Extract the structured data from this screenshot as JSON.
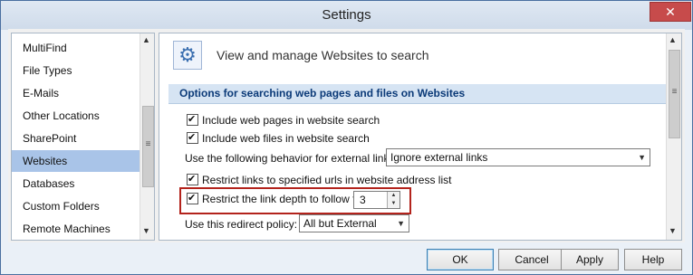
{
  "window": {
    "title": "Settings",
    "close_glyph": "✕"
  },
  "nav": {
    "items": [
      {
        "label": "MultiFind"
      },
      {
        "label": "File Types"
      },
      {
        "label": "E-Mails"
      },
      {
        "label": "Other Locations"
      },
      {
        "label": "SharePoint"
      },
      {
        "label": "Websites",
        "selected": true
      },
      {
        "label": "Databases"
      },
      {
        "label": "Custom Folders"
      },
      {
        "label": "Remote Machines"
      }
    ],
    "scroll_up": "▲",
    "scroll_down": "▼",
    "grip": "≡"
  },
  "panel": {
    "header_icon": "gear-icon",
    "header_glyph": "⚙",
    "header_text": "View and manage Websites to search",
    "section_title": "Options for searching web pages and files on Websites",
    "include_pages": {
      "label": "Include web pages in website search",
      "checked": true
    },
    "include_files": {
      "label": "Include web files in website search",
      "checked": true
    },
    "external_links": {
      "label": "Use the following behavior for external links:",
      "value": "Ignore external links"
    },
    "restrict_urls": {
      "label": "Restrict links to specified urls in website address list",
      "checked": true
    },
    "restrict_depth": {
      "label": "Restrict the link depth to follow to:",
      "checked": true,
      "value": "3"
    },
    "redirect_policy": {
      "label": "Use this redirect policy:",
      "value": "All but External"
    },
    "scroll_up": "▲",
    "scroll_down": "▼",
    "grip": "≡"
  },
  "buttons": {
    "ok": "OK",
    "cancel": "Cancel",
    "apply": "Apply",
    "help": "Help"
  },
  "colors": {
    "highlight": "#b3231c",
    "selected_nav": "#a9c4e8",
    "section_title": "#0b3a78"
  }
}
